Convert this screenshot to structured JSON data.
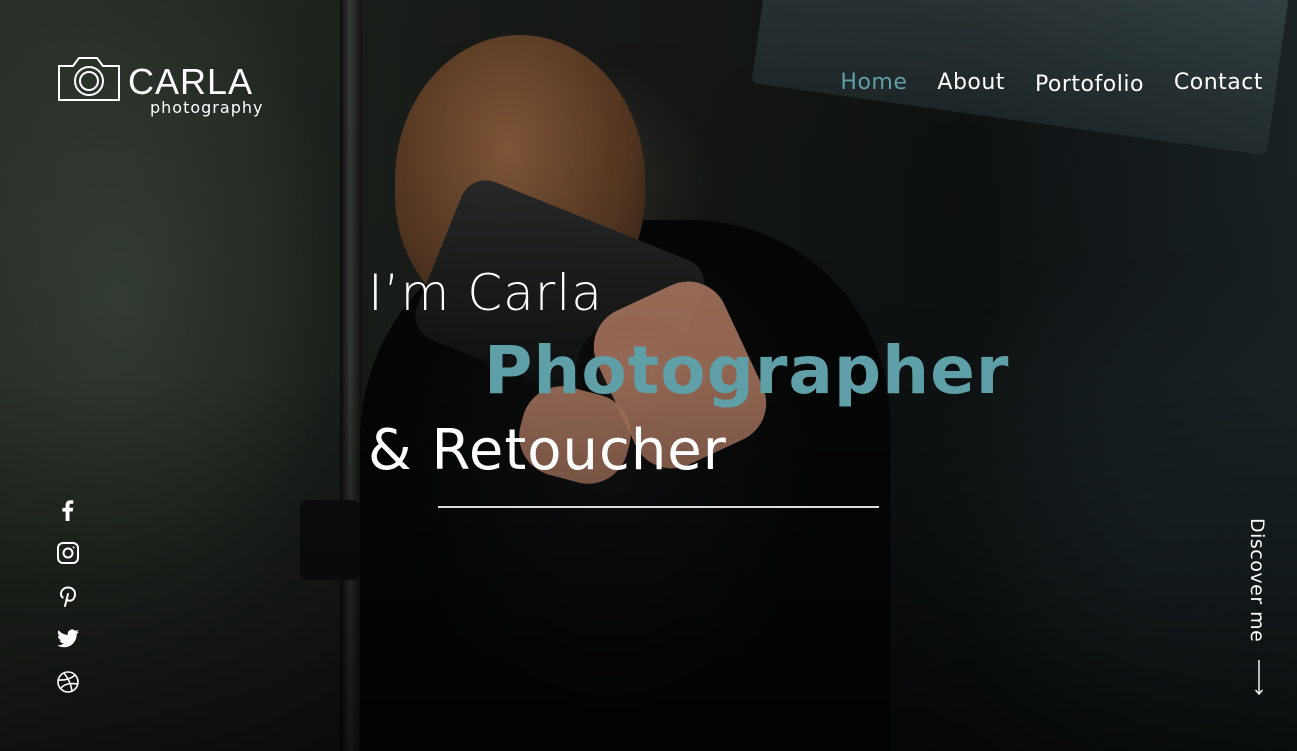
{
  "brand": {
    "name": "CARLA",
    "tagline": "photography",
    "icon": "camera-icon"
  },
  "nav": {
    "items": [
      {
        "label": "Home",
        "active": true
      },
      {
        "label": "About",
        "active": false
      },
      {
        "label": "Portofolio",
        "active": false
      },
      {
        "label": "Contact",
        "active": false
      }
    ]
  },
  "hero": {
    "intro": "I’m Carla",
    "title": "Photographer",
    "subtitle": "& Retoucher"
  },
  "social": {
    "items": [
      {
        "icon": "facebook-icon"
      },
      {
        "icon": "instagram-icon"
      },
      {
        "icon": "pinterest-icon"
      },
      {
        "icon": "twitter-icon"
      },
      {
        "icon": "dribbble-icon"
      }
    ]
  },
  "discover": {
    "label": "Discover me",
    "icon": "arrow-down-icon"
  },
  "colors": {
    "accent": "#5fa0a8",
    "text": "#ffffff"
  }
}
